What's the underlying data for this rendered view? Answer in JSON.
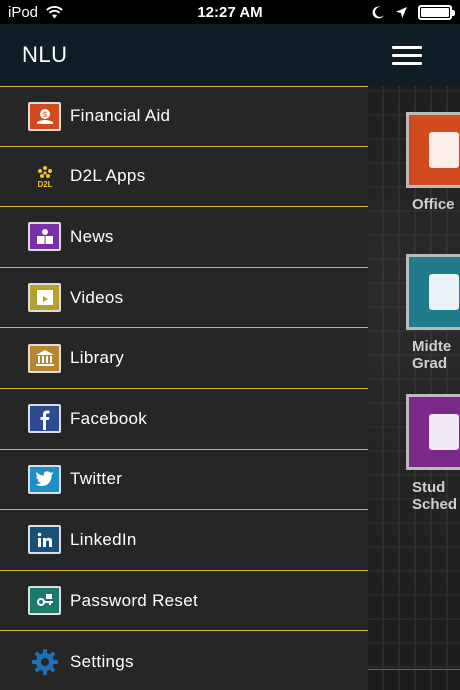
{
  "status_bar": {
    "carrier": "iPod",
    "time": "12:27 AM"
  },
  "drawer": {
    "title": "NLU",
    "items": [
      {
        "label": "Financial Aid",
        "icon": "financial-aid-icon",
        "color": "#d24b1f"
      },
      {
        "label": "D2L Apps",
        "icon": "d2l-icon",
        "color": "#f2c230"
      },
      {
        "label": "News",
        "icon": "news-icon",
        "color": "#7b2fa8"
      },
      {
        "label": "Videos",
        "icon": "videos-icon",
        "color": "#b8a12a"
      },
      {
        "label": "Library",
        "icon": "library-icon",
        "color": "#b8862e"
      },
      {
        "label": "Facebook",
        "icon": "facebook-icon",
        "color": "#2c4b91"
      },
      {
        "label": "Twitter",
        "icon": "twitter-icon",
        "color": "#1d8fc8"
      },
      {
        "label": "LinkedIn",
        "icon": "linkedin-icon",
        "color": "#1a4f78"
      },
      {
        "label": "Password Reset",
        "icon": "password-reset-icon",
        "color": "#1b7a6a"
      },
      {
        "label": "Settings",
        "icon": "settings-icon",
        "color": "#1f6fb5"
      }
    ]
  },
  "background_app": {
    "tiles": [
      {
        "label": "Office"
      },
      {
        "label": "Midte\nGrad"
      },
      {
        "label": "Stud\nSched"
      }
    ]
  },
  "theme": {
    "divider": "#d6b43a",
    "header": "#0f1d26",
    "drawer_bg": "#262626"
  }
}
